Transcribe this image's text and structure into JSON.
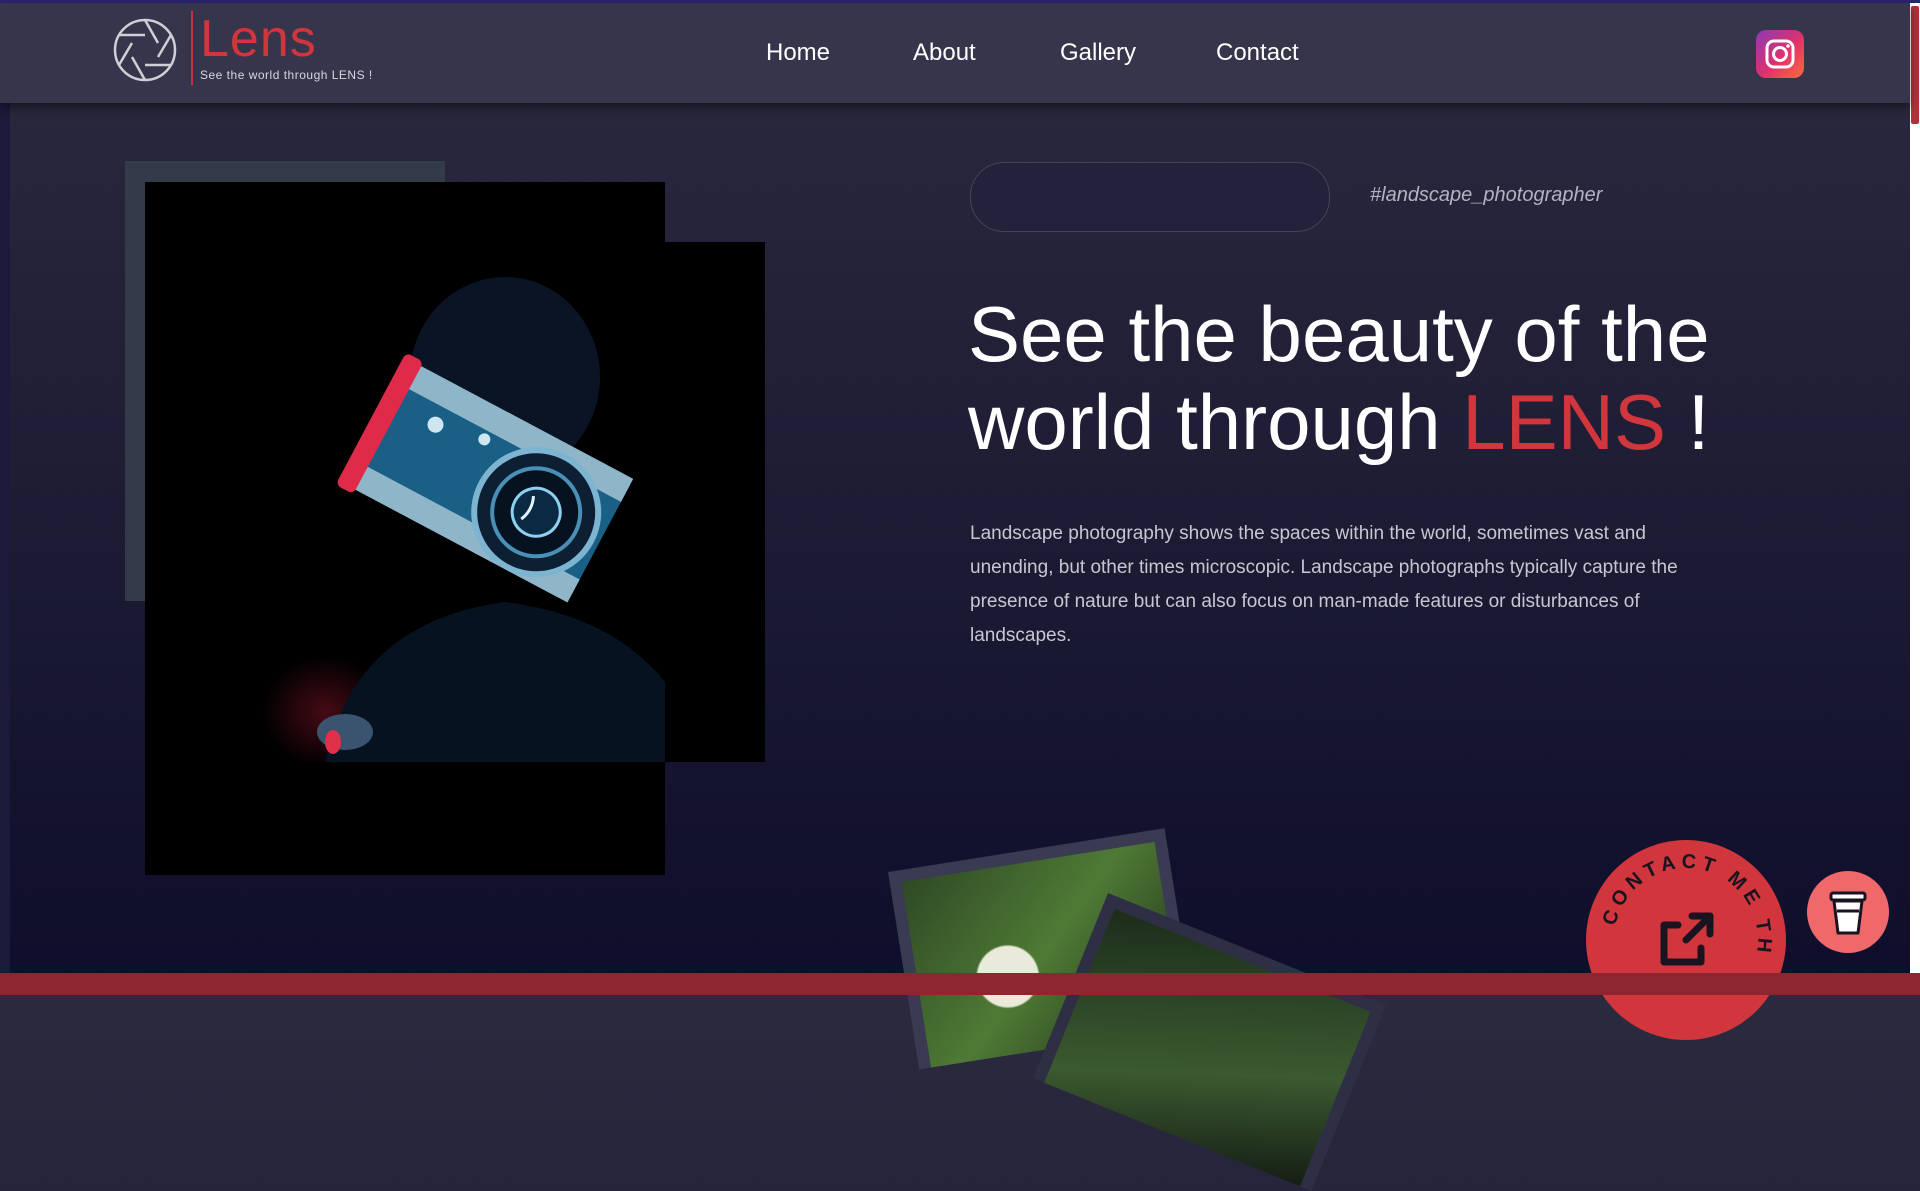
{
  "header": {
    "logo": {
      "word": "Lens",
      "tagline": "See the world through LENS !"
    },
    "nav": [
      {
        "label": "Home"
      },
      {
        "label": "About"
      },
      {
        "label": "Gallery"
      },
      {
        "label": "Contact"
      }
    ],
    "social_icon": "instagram-icon"
  },
  "hero": {
    "hashtag": "#landscape_photographer",
    "headline": {
      "line1": "See the beauty of the",
      "line2_pre": "world through",
      "accent": "LENS",
      "end": "!"
    },
    "description": "Landscape photography shows the spaces within the world, sometimes vast and unending, but other times microscopic. Landscape photographs typically capture the presence of nature but can also focus on man-made features or disturbances of landscapes."
  },
  "badge": {
    "circular_text": "CONTACT ME TH",
    "icon": "external-link-icon"
  },
  "floating_button": {
    "icon": "cup-icon"
  },
  "colors": {
    "accent": "#d0363c",
    "header_bg": "#36354b",
    "bottom_bar": "#8e262f",
    "cup_button": "#f0696a"
  }
}
